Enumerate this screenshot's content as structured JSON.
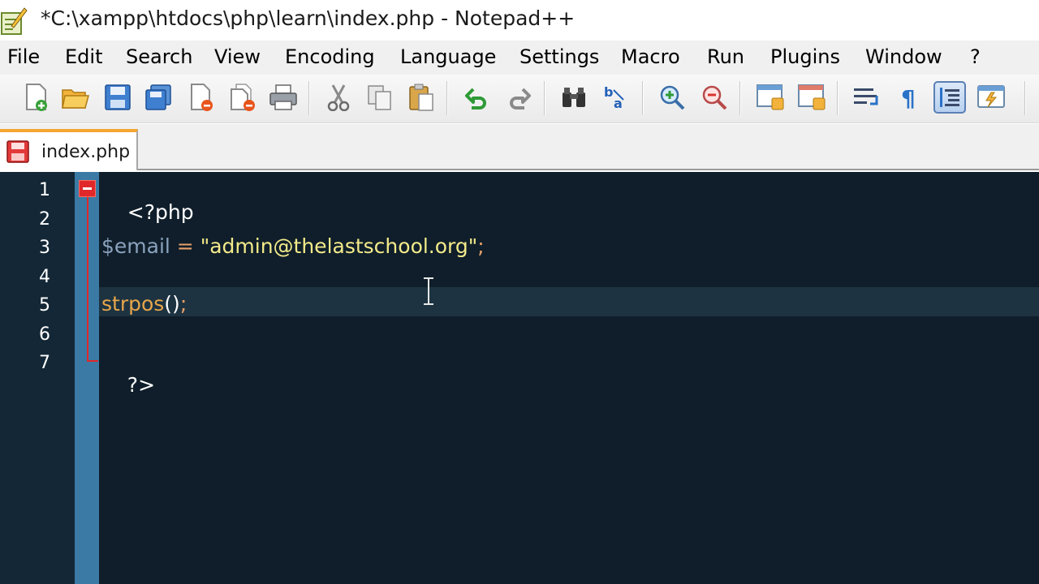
{
  "window": {
    "title": "*C:\\xampp\\htdocs\\php\\learn\\index.php - Notepad++"
  },
  "menu": [
    "File",
    "Edit",
    "Search",
    "View",
    "Encoding",
    "Language",
    "Settings",
    "Macro",
    "Run",
    "Plugins",
    "Window",
    "?"
  ],
  "toolbar": {
    "buttons": [
      "new-file-icon",
      "open-file-icon",
      "save-icon",
      "save-all-icon",
      "close-icon",
      "close-all-icon",
      "print-icon",
      "cut-icon",
      "copy-icon",
      "paste-icon",
      "undo-icon",
      "redo-icon",
      "find-icon",
      "replace-icon",
      "zoom-in-icon",
      "zoom-out-icon",
      "sync-vertical-icon",
      "sync-horizontal-icon",
      "word-wrap-icon",
      "show-all-characters-icon",
      "indent-guide-icon",
      "user-defined-language-icon"
    ]
  },
  "tabs": [
    {
      "label": "index.php",
      "modified": true
    }
  ],
  "editor": {
    "line_numbers": [
      "1",
      "2",
      "3",
      "4",
      "5",
      "6",
      "7"
    ],
    "lines": {
      "l1": {
        "text": "<?php"
      },
      "l3": {
        "var": "$email",
        "op": " = ",
        "str": "\"admin@thelastschool.org\"",
        "end": ";"
      },
      "l5": {
        "func": "strpos",
        "paren": "()",
        "end": ";"
      },
      "l7": {
        "text": "?>"
      }
    },
    "current_line": 5
  },
  "colors": {
    "editor_bg": "#0f1e2a",
    "fold_margin": "#3a7aa5",
    "fold_marker": "#e0282a",
    "string": "#f3ea8a",
    "function": "#e8a64b",
    "variable": "#8aa2bd",
    "tab_accent": "#f5a532"
  }
}
